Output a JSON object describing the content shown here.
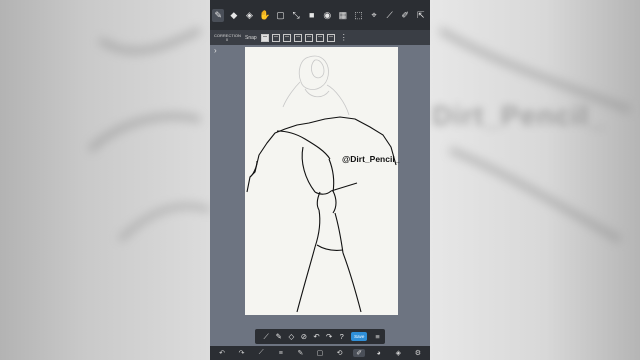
{
  "top_toolbar": {
    "icons": [
      "brush-icon",
      "eraser-icon",
      "fill-icon",
      "hand-icon",
      "rect-select-icon",
      "transform-icon",
      "color-fill-icon",
      "layer-fill-icon",
      "grid-icon",
      "select-icon",
      "magic-wand-icon",
      "eyedropper-icon",
      "pen-icon",
      "export-icon",
      "window-icon"
    ]
  },
  "sub_toolbar": {
    "correction_label": "CORRECTION",
    "correction_value": "0",
    "snap_label": "Snap",
    "more_icon": "more-icon"
  },
  "canvas": {
    "watermark": "@Dirt_Pencil_"
  },
  "bottom_toolbar": {
    "save_label": "Save"
  },
  "background_blur_text": "Dirt_Pencil_"
}
